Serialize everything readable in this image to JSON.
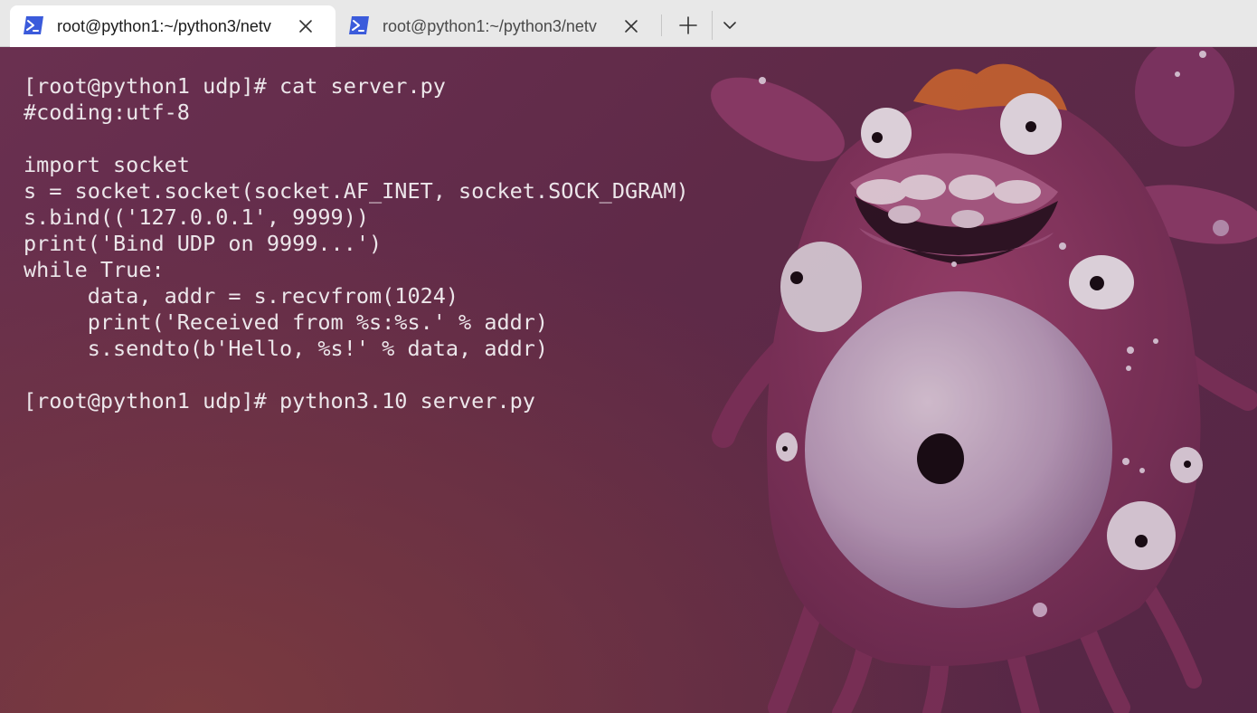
{
  "tabs": [
    {
      "title": "root@python1:~/python3/netv",
      "icon": "powershell-icon",
      "active": true
    },
    {
      "title": "root@python1:~/python3/netv",
      "icon": "powershell-icon",
      "active": false
    }
  ],
  "tabbar": {
    "new_tab_icon": "plus-icon",
    "dropdown_icon": "chevron-down-icon",
    "close_icon": "close-icon"
  },
  "terminal": {
    "lines": [
      "[root@python1 udp]# cat server.py",
      "#coding:utf-8",
      "",
      "import socket",
      "s = socket.socket(socket.AF_INET, socket.SOCK_DGRAM)",
      "s.bind(('127.0.0.1', 9999))",
      "print('Bind UDP on 9999...')",
      "while True:",
      "     data, addr = s.recvfrom(1024)",
      "     print('Received from %s:%s.' % addr)",
      "     s.sendto(b'Hello, %s!' % data, addr)",
      "",
      "[root@python1 udp]# python3.10 server.py"
    ]
  },
  "colors": {
    "terminal_text": "#ece6ea",
    "terminal_bg": "#5e2a47",
    "tab_icon": "#3b5bdb",
    "tabbar_bg": "#e8e8e8"
  }
}
